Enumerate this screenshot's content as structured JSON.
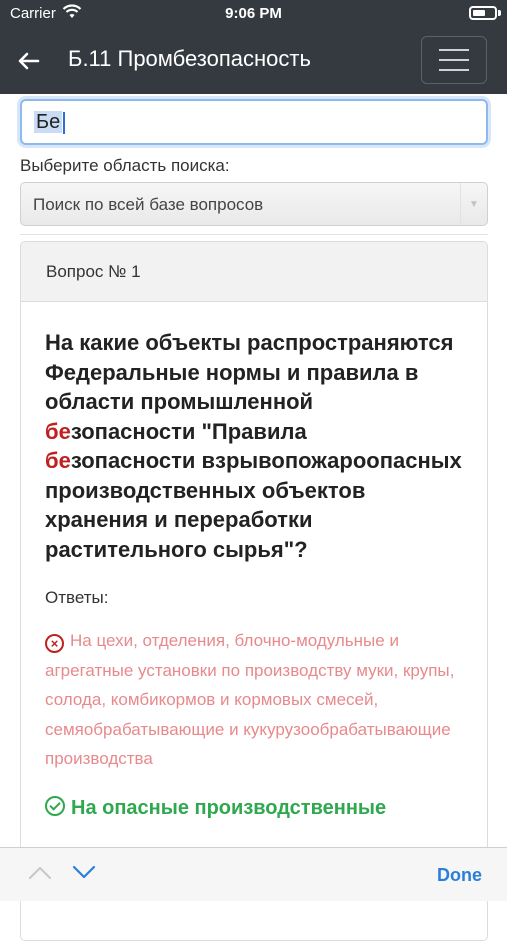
{
  "status_bar": {
    "carrier": "Carrier",
    "time": "9:06 PM"
  },
  "nav": {
    "title": "Б.11 Промбезопасность"
  },
  "search": {
    "value": "Бе"
  },
  "area": {
    "label": "Выберите область поиска:",
    "selected": "Поиск по всей базе вопросов"
  },
  "card": {
    "header": "Вопрос № 1",
    "question_parts": [
      "На какие объекты распространяются Федеральные нормы и правила в области промышленной ",
      "бе",
      "зопасности \"Правила ",
      "бе",
      "зопасности взрывопожароопасных производственных объектов хранения и переработки растительного сырья\"?"
    ],
    "answers_label": "Ответы:",
    "answer_wrong": "На цехи, отделения, блочно-модульные и агрегатные установки по производству муки, крупы, солода, комбикормов и кормовых смесей, семяобрабатывающие и кукурузообрабатывающие производства",
    "answer_right": "На опасные производственные"
  },
  "accessory": {
    "done_label": "Done"
  },
  "colors": {
    "nav_bg": "#343a40",
    "highlight": "#c0201f",
    "wrong": "#e8898c",
    "right": "#2fa84f",
    "done": "#2a7fd8"
  }
}
